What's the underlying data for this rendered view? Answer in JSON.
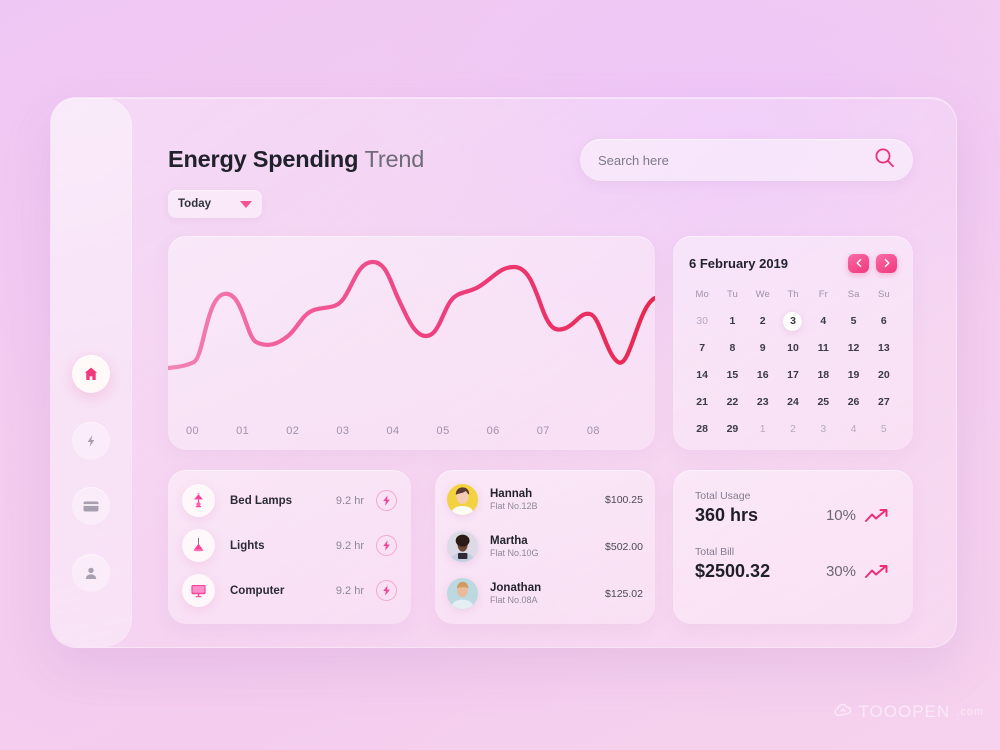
{
  "theme": {
    "accent": "#f0397d",
    "accent_soft": "#fa6aa6",
    "bg": "#f1c9f2",
    "text_dark": "#21212b",
    "text_muted": "#8d8796"
  },
  "sidebar": {
    "items": [
      {
        "icon": "home-icon",
        "label": "Home",
        "active": true
      },
      {
        "icon": "energy-bolt-icon",
        "label": "Energy",
        "active": false
      },
      {
        "icon": "card-icon",
        "label": "Billing",
        "active": false
      },
      {
        "icon": "person-icon",
        "label": "Profile",
        "active": false
      }
    ]
  },
  "header": {
    "title_strong": "Energy Spending",
    "title_light": "Trend",
    "dropdown": {
      "value": "Today",
      "icon": "chevron-down-icon"
    },
    "search": {
      "value": "",
      "placeholder": "Search here",
      "icon": "search-icon"
    }
  },
  "chart_data": {
    "type": "line",
    "title": "Energy Spending Trend",
    "xlabel": "",
    "ylabel": "",
    "categories": [
      "00",
      "01",
      "02",
      "03",
      "04",
      "05",
      "06",
      "07",
      "08"
    ],
    "x": [
      0,
      1,
      2,
      3,
      4,
      5,
      6,
      7,
      8
    ],
    "values": [
      22,
      63,
      35,
      52,
      78,
      38,
      72,
      30,
      62
    ],
    "series": [
      {
        "name": "Energy spending",
        "values": [
          22,
          63,
          35,
          52,
          78,
          38,
          72,
          30,
          62
        ]
      }
    ],
    "ylim": [
      0,
      100
    ],
    "grid": false,
    "legend": "none",
    "line_color_start": "#f07fb2",
    "line_color_end": "#e8274f",
    "smoothing": "spline"
  },
  "calendar": {
    "title": "6 February  2019",
    "prev_icon": "chevron-left-icon",
    "next_icon": "chevron-right-icon",
    "day_headers": [
      "Mo",
      "Tu",
      "We",
      "Th",
      "Fr",
      "Sa",
      "Su"
    ],
    "selected_day": 3,
    "weeks": [
      [
        {
          "d": "30",
          "m": true
        },
        {
          "d": "1"
        },
        {
          "d": "2"
        },
        {
          "d": "3",
          "sel": true
        },
        {
          "d": "4"
        },
        {
          "d": "5"
        },
        {
          "d": "6"
        }
      ],
      [
        {
          "d": "7"
        },
        {
          "d": "8"
        },
        {
          "d": "9"
        },
        {
          "d": "10"
        },
        {
          "d": "11"
        },
        {
          "d": "12"
        },
        {
          "d": "13"
        }
      ],
      [
        {
          "d": "14"
        },
        {
          "d": "15"
        },
        {
          "d": "16"
        },
        {
          "d": "17"
        },
        {
          "d": "18"
        },
        {
          "d": "19"
        },
        {
          "d": "20"
        }
      ],
      [
        {
          "d": "21"
        },
        {
          "d": "22"
        },
        {
          "d": "23"
        },
        {
          "d": "24"
        },
        {
          "d": "25"
        },
        {
          "d": "26"
        },
        {
          "d": "27"
        }
      ],
      [
        {
          "d": "28"
        },
        {
          "d": "29"
        },
        {
          "d": "1",
          "m": true
        },
        {
          "d": "2",
          "m": true
        },
        {
          "d": "3",
          "m": true
        },
        {
          "d": "4",
          "m": true
        },
        {
          "d": "5",
          "m": true
        }
      ]
    ]
  },
  "devices": {
    "items": [
      {
        "icon": "table-lamp-icon",
        "name": "Bed Lamps",
        "time": "9.2 hr",
        "action_icon": "bolt-icon"
      },
      {
        "icon": "pendant-lamp-icon",
        "name": "Lights",
        "time": "9.2 hr",
        "action_icon": "bolt-icon"
      },
      {
        "icon": "monitor-icon",
        "name": "Computer",
        "time": "9.2 hr",
        "action_icon": "bolt-icon"
      }
    ]
  },
  "people": {
    "items": [
      {
        "name": "Hannah",
        "flat": "Flat No.12B",
        "amount": "$100.25",
        "avatar_bg": "#f2d33f"
      },
      {
        "name": "Martha",
        "flat": "Flat No.10G",
        "amount": "$502.00",
        "avatar_bg": "#d8d6e2"
      },
      {
        "name": "Jonathan",
        "flat": "Flat No.08A",
        "amount": "$125.02",
        "avatar_bg": "#bcd9e2"
      }
    ]
  },
  "stats": {
    "blocks": [
      {
        "label": "Total Usage",
        "value": "360 hrs",
        "percent": "10%",
        "trend_icon": "trend-up-icon"
      },
      {
        "label": "Total Bill",
        "value": "$2500.32",
        "percent": "30%",
        "trend_icon": "trend-up-icon"
      }
    ]
  },
  "watermark": {
    "text": "TOOOPEN",
    "suffix": ".com",
    "icon": "cloud-icon"
  }
}
